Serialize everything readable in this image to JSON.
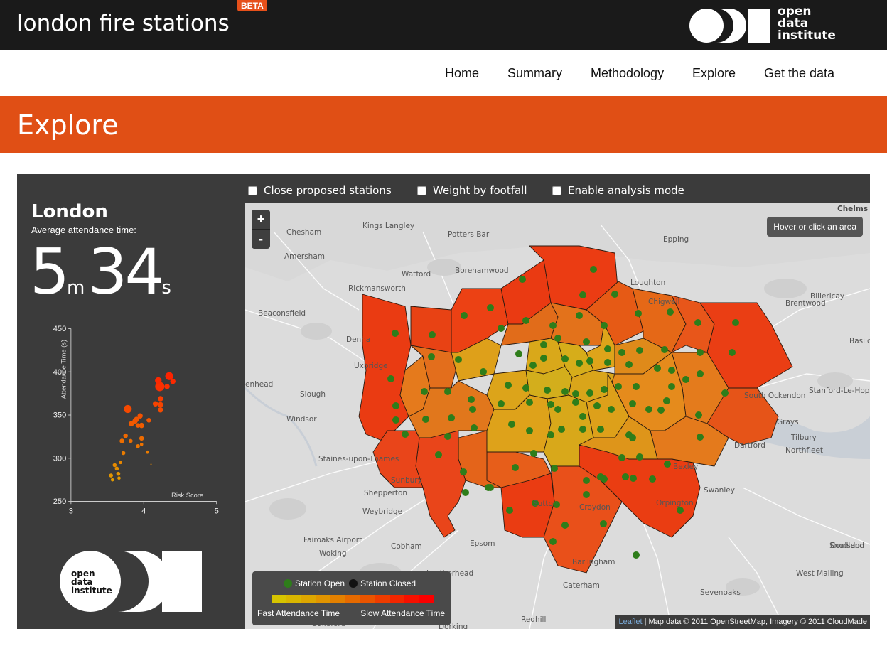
{
  "header": {
    "site_title": "london fire stations",
    "beta_badge": "BETA",
    "logo_text": [
      "open",
      "data",
      "institute"
    ]
  },
  "nav": {
    "items": [
      "Home",
      "Summary",
      "Methodology",
      "Explore",
      "Get the data"
    ]
  },
  "banner": {
    "title": "Explore"
  },
  "options": {
    "close_proposed": "Close proposed stations",
    "weight_footfall": "Weight by footfall",
    "analysis_mode": "Enable analysis mode"
  },
  "sidebar": {
    "area_name": "London",
    "avg_label": "Average attendance time:",
    "minutes": "5",
    "minutes_unit": "m",
    "seconds": "34",
    "seconds_unit": "s"
  },
  "chart_data": {
    "type": "scatter",
    "xlabel": "Risk Score",
    "ylabel": "Attendance Time (s)",
    "xlim": [
      3,
      5
    ],
    "ylim": [
      250,
      450
    ],
    "xticks": [
      "3",
      "4",
      "5"
    ],
    "yticks": [
      "250",
      "300",
      "350",
      "400",
      "450"
    ],
    "points": [
      {
        "x": 4.35,
        "y": 395,
        "size": 6
      },
      {
        "x": 4.22,
        "y": 383,
        "size": 7
      },
      {
        "x": 4.4,
        "y": 389,
        "size": 4
      },
      {
        "x": 4.2,
        "y": 390,
        "size": 5
      },
      {
        "x": 4.32,
        "y": 383,
        "size": 4
      },
      {
        "x": 4.23,
        "y": 369,
        "size": 4
      },
      {
        "x": 4.16,
        "y": 363,
        "size": 4
      },
      {
        "x": 4.23,
        "y": 362,
        "size": 4
      },
      {
        "x": 4.23,
        "y": 356,
        "size": 4
      },
      {
        "x": 3.78,
        "y": 357,
        "size": 6
      },
      {
        "x": 4.07,
        "y": 344,
        "size": 3.5
      },
      {
        "x": 3.95,
        "y": 349,
        "size": 4
      },
      {
        "x": 3.88,
        "y": 343,
        "size": 4
      },
      {
        "x": 3.92,
        "y": 338,
        "size": 3.5
      },
      {
        "x": 3.83,
        "y": 340,
        "size": 4
      },
      {
        "x": 3.9,
        "y": 345,
        "size": 4
      },
      {
        "x": 3.97,
        "y": 338,
        "size": 4
      },
      {
        "x": 3.75,
        "y": 326,
        "size": 3.5
      },
      {
        "x": 3.7,
        "y": 320,
        "size": 3.5
      },
      {
        "x": 3.82,
        "y": 320,
        "size": 3
      },
      {
        "x": 3.97,
        "y": 323,
        "size": 3.5
      },
      {
        "x": 3.92,
        "y": 314,
        "size": 3
      },
      {
        "x": 3.97,
        "y": 316,
        "size": 2.5
      },
      {
        "x": 4.05,
        "y": 307,
        "size": 2.5
      },
      {
        "x": 3.72,
        "y": 306,
        "size": 3
      },
      {
        "x": 3.6,
        "y": 292,
        "size": 3
      },
      {
        "x": 3.63,
        "y": 288,
        "size": 3
      },
      {
        "x": 3.68,
        "y": 295,
        "size": 2.5
      },
      {
        "x": 3.65,
        "y": 282,
        "size": 3
      },
      {
        "x": 3.55,
        "y": 280,
        "size": 3
      },
      {
        "x": 3.57,
        "y": 275,
        "size": 2.5
      },
      {
        "x": 3.66,
        "y": 277,
        "size": 2.5
      },
      {
        "x": 4.1,
        "y": 293,
        "size": 1
      }
    ]
  },
  "map": {
    "zoom_in": "+",
    "zoom_out": "-",
    "hover_info": "Hover or click an area",
    "legend": {
      "open": "Station Open",
      "closed": "Station Closed",
      "fast": "Fast Attendance Time",
      "slow": "Slow Attendance Time",
      "open_color": "#2e7d1a",
      "closed_color": "#111111"
    },
    "attribution_link": "Leaflet",
    "attribution": " | Map data © 2011 OpenStreetMap, Imagery © 2011 CloudMade",
    "places": [
      "Chelms",
      "Kings Langley",
      "Chesham",
      "Potters Bar",
      "Epping",
      "Amersham",
      "Watford",
      "Borehamwood",
      "Loughton",
      "Rickmansworth",
      "Billericay",
      "Chigwell",
      "Beaconsfield",
      "Brentwood",
      "Denha",
      "Basild",
      "Uxbridge",
      "Slough",
      "South Ockendon",
      "Stanford-Le-Hope",
      "Windsor",
      "Grays",
      "Tilbury",
      "Dartford",
      "Northfleet",
      "Staines-upon-Thames",
      "Sunbury",
      "Swanley",
      "Shepperton",
      "Weybridge",
      "Fairoaks Airport",
      "Cobham",
      "Epsom",
      "Woking",
      "Coulsdon",
      "Leatherhead",
      "Caterham",
      "Sevenoaks",
      "Snodland",
      "West Malling",
      "Redhill",
      "Guildford",
      "Dorking",
      "enhead",
      "Orpington",
      "Barlingham",
      "Sutton",
      "Croydon",
      "Bexley"
    ]
  }
}
